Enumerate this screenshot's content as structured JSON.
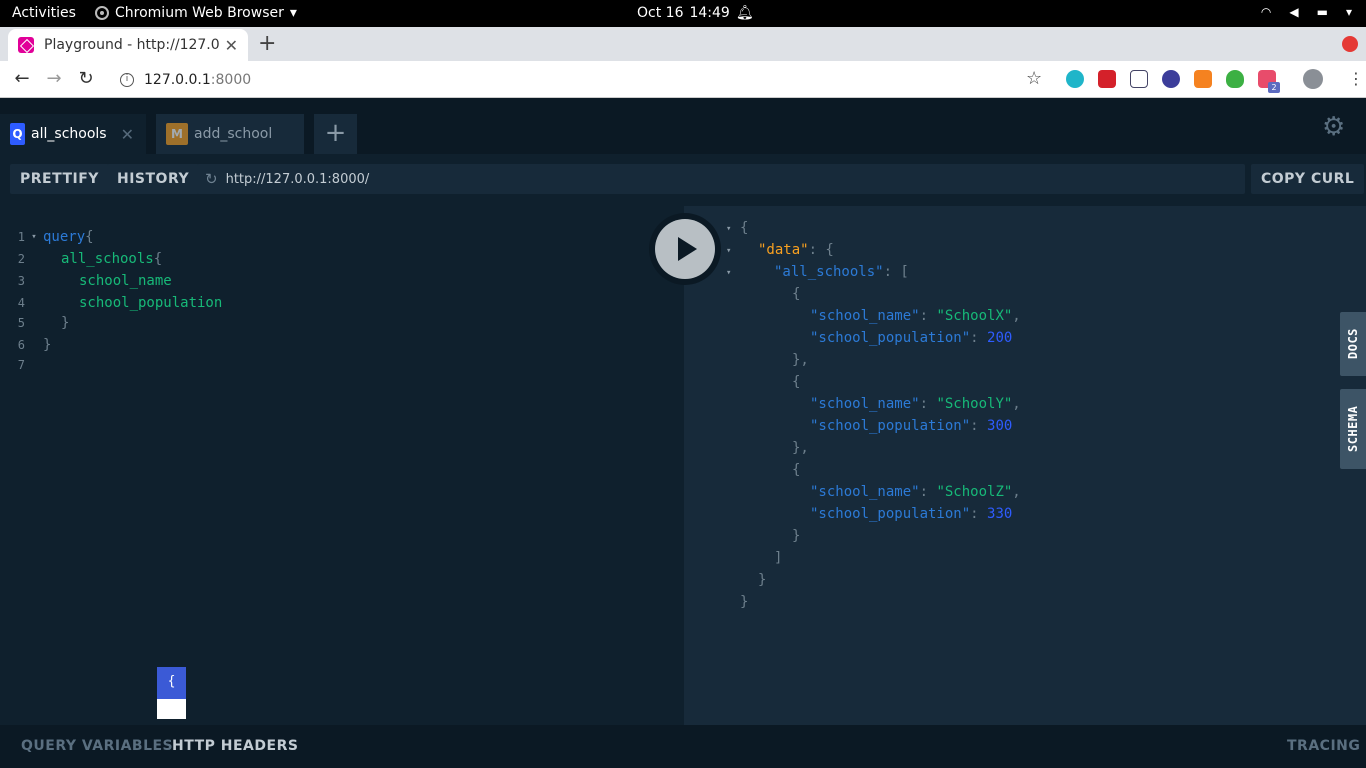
{
  "system": {
    "activities": "Activities",
    "app_name": "Chromium Web Browser",
    "date": "Oct 16",
    "time": "14:49"
  },
  "browser": {
    "tab_title": "Playground - http://127.0.0",
    "url_host": "127.0.0.1",
    "url_port": ":8000",
    "extension_badge": "2"
  },
  "playground": {
    "tabs": [
      {
        "badge": "Q",
        "label": "all_schools"
      },
      {
        "badge": "M",
        "label": "add_school"
      }
    ],
    "add_tab": "+",
    "prettify": "PRETTIFY",
    "history": "HISTORY",
    "endpoint": "http://127.0.0.1:8000/",
    "copy_curl": "COPY CURL",
    "docs": "DOCS",
    "schema": "SCHEMA",
    "query_variables": "QUERY VARIABLES",
    "http_headers": "HTTP HEADERS",
    "tracing": "TRACING",
    "autocomplete_hint": "{"
  },
  "query_lines": [
    {
      "n": "1",
      "text": "query",
      "punct": "{"
    },
    {
      "n": "2",
      "text": "all_schools",
      "punct": "{"
    },
    {
      "n": "3",
      "text": "school_name",
      "punct": ""
    },
    {
      "n": "4",
      "text": "school_population",
      "punct": ""
    },
    {
      "n": "5",
      "text": "",
      "punct": "}"
    },
    {
      "n": "6",
      "text": "",
      "punct": "}"
    },
    {
      "n": "7",
      "text": "",
      "punct": ""
    }
  ],
  "result": {
    "data_key": "\"data\"",
    "list_key": "\"all_schools\"",
    "name_key": "\"school_name\"",
    "pop_key": "\"school_population\"",
    "items": [
      {
        "name": "\"SchoolX\"",
        "population": "200"
      },
      {
        "name": "\"SchoolY\"",
        "population": "300"
      },
      {
        "name": "\"SchoolZ\"",
        "population": "330"
      }
    ]
  }
}
